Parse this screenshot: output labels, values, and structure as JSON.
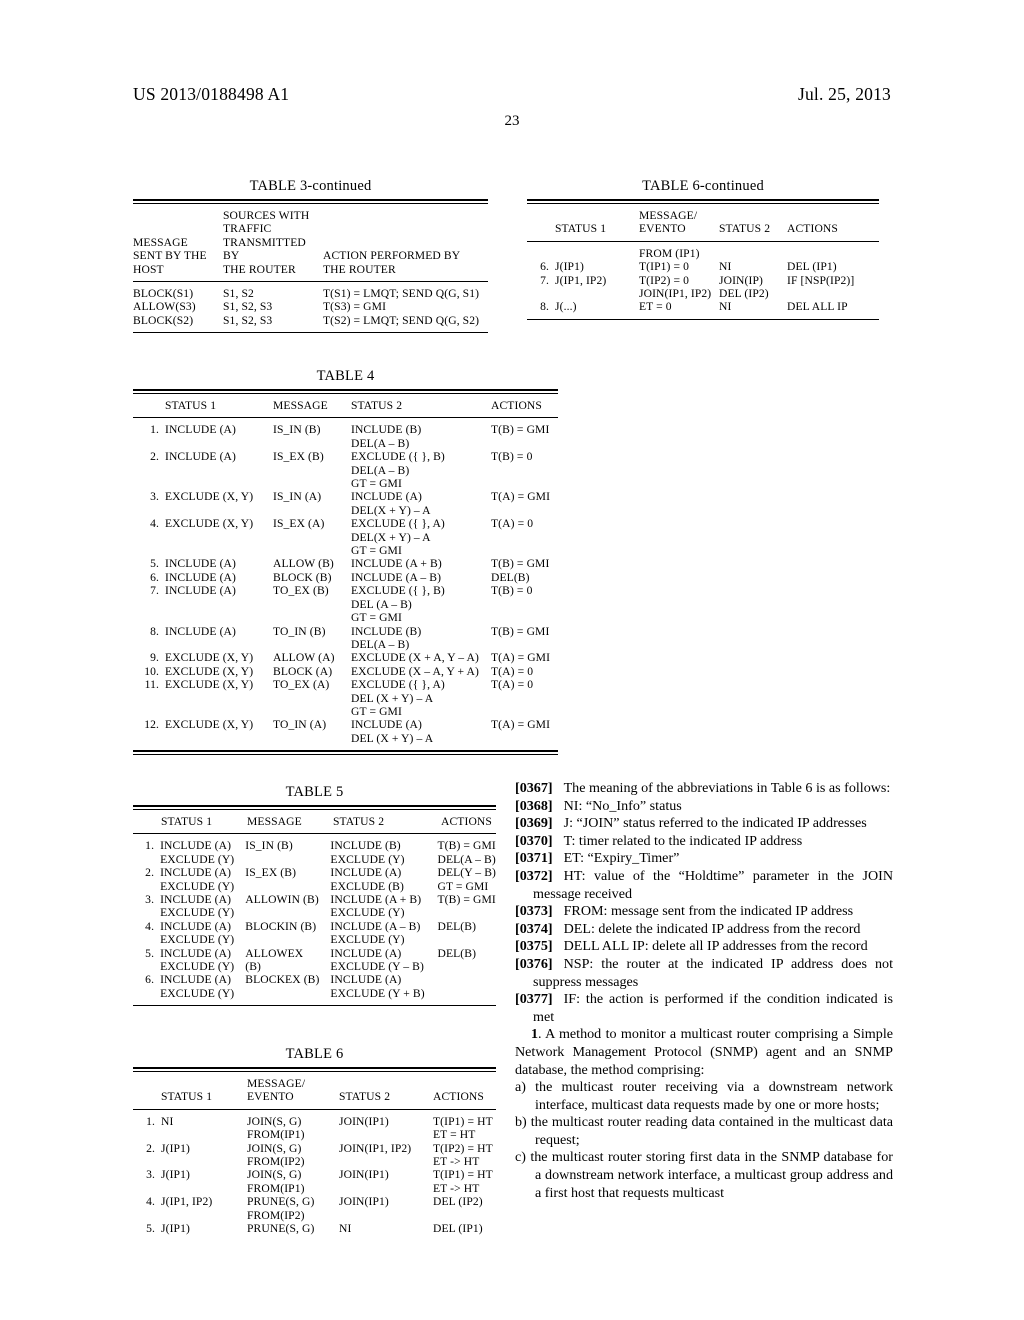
{
  "header": {
    "publication_number": "US 2013/0188498 A1",
    "publication_date": "Jul. 25, 2013",
    "page_number": "23"
  },
  "table3_continued": {
    "caption": "TABLE 3-continued",
    "headers": [
      [
        "",
        "SOURCES WITH",
        ""
      ],
      [
        "",
        "TRAFFIC",
        ""
      ],
      [
        "MESSAGE",
        "TRANSMITTED",
        ""
      ],
      [
        "SENT BY THE",
        "BY",
        "ACTION PERFORMED BY"
      ],
      [
        "HOST",
        "THE ROUTER",
        "THE ROUTER"
      ]
    ],
    "rows": [
      [
        "BLOCK(S1)",
        "S1, S2",
        "T(S1) = LMQT; SEND Q(G, S1)"
      ],
      [
        "ALLOW(S3)",
        "S1, S2, S3",
        "T(S3) = GMI"
      ],
      [
        "BLOCK(S2)",
        "S1, S2, S3",
        "T(S2) = LMQT; SEND Q(G, S2)"
      ]
    ]
  },
  "table6_continued": {
    "caption": "TABLE 6-continued",
    "headers_line1": [
      "",
      "",
      "MESSAGE/",
      "",
      ""
    ],
    "headers_line2": [
      "",
      "STATUS 1",
      "EVENTO",
      "STATUS 2",
      "ACTIONS"
    ],
    "rows": [
      {
        "num": "",
        "status1": "",
        "message": "FROM (IP1)",
        "status2": "",
        "actions": ""
      },
      {
        "num": "6.",
        "status1": "J(IP1)",
        "message": "T(IP1) = 0",
        "status2": "NI",
        "actions": "DEL (IP1)"
      },
      {
        "num": "7.",
        "status1": "J(IP1, IP2)",
        "message": "T(IP2) = 0",
        "status2": "JOIN(IP)",
        "actions": "IF [NSP(IP2)]"
      },
      {
        "num": "",
        "status1": "",
        "message": "JOIN(IP1, IP2)",
        "status2": "DEL (IP2)",
        "actions": ""
      },
      {
        "num": "8.",
        "status1": "J(...)",
        "message": "ET = 0",
        "status2": "NI",
        "actions": "DEL ALL IP"
      }
    ]
  },
  "table4": {
    "caption": "TABLE 4",
    "headers": [
      "",
      "STATUS 1",
      "MESSAGE",
      "STATUS 2",
      "ACTIONS"
    ],
    "rows": [
      {
        "num": "1.",
        "status1": "INCLUDE (A)",
        "message": "IS_IN (B)",
        "status2": "INCLUDE (B)",
        "actions": "T(B) = GMI"
      },
      {
        "num": "",
        "status1": "",
        "message": "",
        "status2": "DEL(A – B)",
        "actions": ""
      },
      {
        "num": "2.",
        "status1": "INCLUDE (A)",
        "message": "IS_EX (B)",
        "status2": "EXCLUDE ({ }, B)",
        "actions": "T(B) = 0"
      },
      {
        "num": "",
        "status1": "",
        "message": "",
        "status2": "DEL(A – B)",
        "actions": ""
      },
      {
        "num": "",
        "status1": "",
        "message": "",
        "status2": "GT = GMI",
        "actions": ""
      },
      {
        "num": "3.",
        "status1": "EXCLUDE (X, Y)",
        "message": "IS_IN (A)",
        "status2": "INCLUDE (A)",
        "actions": "T(A) = GMI"
      },
      {
        "num": "",
        "status1": "",
        "message": "",
        "status2": "DEL(X + Y) – A",
        "actions": ""
      },
      {
        "num": "4.",
        "status1": "EXCLUDE (X, Y)",
        "message": "IS_EX (A)",
        "status2": "EXCLUDE ({ }, A)",
        "actions": "T(A) = 0"
      },
      {
        "num": "",
        "status1": "",
        "message": "",
        "status2": "DEL(X + Y) – A",
        "actions": ""
      },
      {
        "num": "",
        "status1": "",
        "message": "",
        "status2": "GT = GMI",
        "actions": ""
      },
      {
        "num": "5.",
        "status1": "INCLUDE (A)",
        "message": "ALLOW (B)",
        "status2": "INCLUDE (A + B)",
        "actions": "T(B) = GMI"
      },
      {
        "num": "6.",
        "status1": "INCLUDE (A)",
        "message": "BLOCK (B)",
        "status2": "INCLUDE (A – B)",
        "actions": "DEL(B)"
      },
      {
        "num": "7.",
        "status1": "INCLUDE (A)",
        "message": "TO_EX (B)",
        "status2": "EXCLUDE ({ }, B)",
        "actions": "T(B) = 0"
      },
      {
        "num": "",
        "status1": "",
        "message": "",
        "status2": "DEL (A – B)",
        "actions": ""
      },
      {
        "num": "",
        "status1": "",
        "message": "",
        "status2": "GT = GMI",
        "actions": ""
      },
      {
        "num": "8.",
        "status1": "INCLUDE (A)",
        "message": "TO_IN (B)",
        "status2": "INCLUDE (B)",
        "actions": "T(B) = GMI"
      },
      {
        "num": "",
        "status1": "",
        "message": "",
        "status2": "DEL(A – B)",
        "actions": ""
      },
      {
        "num": "9.",
        "status1": "EXCLUDE (X, Y)",
        "message": "ALLOW (A)",
        "status2": "EXCLUDE (X + A, Y – A)",
        "actions": "T(A) = GMI"
      },
      {
        "num": "10.",
        "status1": "EXCLUDE (X, Y)",
        "message": "BLOCK (A)",
        "status2": "EXCLUDE (X – A, Y + A)",
        "actions": "T(A) = 0"
      },
      {
        "num": "11.",
        "status1": "EXCLUDE (X, Y)",
        "message": "TO_EX (A)",
        "status2": "EXCLUDE ({ }, A)",
        "actions": "T(A) = 0"
      },
      {
        "num": "",
        "status1": "",
        "message": "",
        "status2": "DEL (X + Y) – A",
        "actions": ""
      },
      {
        "num": "",
        "status1": "",
        "message": "",
        "status2": "GT = GMI",
        "actions": ""
      },
      {
        "num": "12.",
        "status1": "EXCLUDE (X, Y)",
        "message": "TO_IN (A)",
        "status2": "INCLUDE (A)",
        "actions": "T(A) = GMI"
      },
      {
        "num": "",
        "status1": "",
        "message": "",
        "status2": "DEL (X + Y) – A",
        "actions": ""
      }
    ]
  },
  "table5": {
    "caption": "TABLE 5",
    "headers": [
      "",
      "STATUS 1",
      "MESSAGE",
      "STATUS 2",
      "ACTIONS"
    ],
    "rows": [
      {
        "num": "1.",
        "status1": "INCLUDE (A)",
        "message": "IS_IN (B)",
        "status2": "INCLUDE (B)",
        "actions": "T(B) = GMI"
      },
      {
        "num": "",
        "status1": "EXCLUDE (Y)",
        "message": "",
        "status2": "EXCLUDE (Y)",
        "actions": "DEL(A – B)"
      },
      {
        "num": "2.",
        "status1": "INCLUDE (A)",
        "message": "IS_EX (B)",
        "status2": "INCLUDE (A)",
        "actions": "DEL(Y – B)"
      },
      {
        "num": "",
        "status1": "EXCLUDE (Y)",
        "message": "",
        "status2": "EXCLUDE (B)",
        "actions": "GT = GMI"
      },
      {
        "num": "3.",
        "status1": "INCLUDE (A)",
        "message": "ALLOWIN (B)",
        "status2": "INCLUDE (A + B)",
        "actions": "T(B) = GMI"
      },
      {
        "num": "",
        "status1": "EXCLUDE (Y)",
        "message": "",
        "status2": "EXCLUDE (Y)",
        "actions": ""
      },
      {
        "num": "4.",
        "status1": "INCLUDE (A)",
        "message": "BLOCKIN (B)",
        "status2": "INCLUDE (A – B)",
        "actions": "DEL(B)"
      },
      {
        "num": "",
        "status1": "EXCLUDE (Y)",
        "message": "",
        "status2": "EXCLUDE (Y)",
        "actions": ""
      },
      {
        "num": "5.",
        "status1": "INCLUDE (A)",
        "message": "ALLOWEX",
        "status2": "INCLUDE (A)",
        "actions": "DEL(B)"
      },
      {
        "num": "",
        "status1": "EXCLUDE (Y)",
        "message": "(B)",
        "status2": "EXCLUDE (Y – B)",
        "actions": ""
      },
      {
        "num": "6.",
        "status1": "INCLUDE (A)",
        "message": "BLOCKEX (B)",
        "status2": "INCLUDE (A)",
        "actions": ""
      },
      {
        "num": "",
        "status1": "EXCLUDE (Y)",
        "message": "",
        "status2": "EXCLUDE (Y + B)",
        "actions": ""
      }
    ]
  },
  "table6": {
    "caption": "TABLE 6",
    "headers_line1": [
      "",
      "",
      "MESSAGE/",
      "",
      ""
    ],
    "headers_line2": [
      "",
      "STATUS 1",
      "EVENTO",
      "STATUS 2",
      "ACTIONS"
    ],
    "rows": [
      {
        "num": "1.",
        "status1": "NI",
        "message": "JOIN(S, G)",
        "status2": "JOIN(IP1)",
        "actions": "T(IP1) = HT"
      },
      {
        "num": "",
        "status1": "",
        "message": "FROM(IP1)",
        "status2": "",
        "actions": "ET = HT"
      },
      {
        "num": "2.",
        "status1": "J(IP1)",
        "message": "JOIN(S, G)",
        "status2": "JOIN(IP1, IP2)",
        "actions": "T(IP2) = HT"
      },
      {
        "num": "",
        "status1": "",
        "message": "FROM(IP2)",
        "status2": "",
        "actions": "ET -> HT"
      },
      {
        "num": "3.",
        "status1": "J(IP1)",
        "message": "JOIN(S, G)",
        "status2": "JOIN(IP1)",
        "actions": "T(IP1) = HT"
      },
      {
        "num": "",
        "status1": "",
        "message": "FROM(IP1)",
        "status2": "",
        "actions": "ET -> HT"
      },
      {
        "num": "4.",
        "status1": "J(IP1, IP2)",
        "message": "PRUNE(S, G)",
        "status2": "JOIN(IP1)",
        "actions": "DEL (IP2)"
      },
      {
        "num": "",
        "status1": "",
        "message": "FROM(IP2)",
        "status2": "",
        "actions": ""
      },
      {
        "num": "5.",
        "status1": "J(IP1)",
        "message": "PRUNE(S, G)",
        "status2": "NI",
        "actions": "DEL (IP1)"
      }
    ]
  },
  "body_text": {
    "p0367": {
      "tag": "[0367]",
      "text": "The meaning of the abbreviations in Table 6 is as follows:"
    },
    "p0368": {
      "tag": "[0368]",
      "text": "NI: “No_Info” status"
    },
    "p0369": {
      "tag": "[0369]",
      "text": "J: “JOIN” status referred to the indicated IP addresses"
    },
    "p0370": {
      "tag": "[0370]",
      "text": "T: timer related to the indicated IP address"
    },
    "p0371": {
      "tag": "[0371]",
      "text": "ET: “Expiry_Timer”"
    },
    "p0372": {
      "tag": "[0372]",
      "text": "HT: value of the “Holdtime” parameter in the JOIN message received"
    },
    "p0373": {
      "tag": "[0373]",
      "text": "FROM: message sent from the indicated IP address"
    },
    "p0374": {
      "tag": "[0374]",
      "text": "DEL: delete the indicated IP address from the record"
    },
    "p0375": {
      "tag": "[0375]",
      "text": "DELL ALL IP: delete all IP addresses from the record"
    },
    "p0376": {
      "tag": "[0376]",
      "text": "NSP: the router at the indicated IP address does not suppress messages"
    },
    "p0377": {
      "tag": "[0377]",
      "text": "IF: the action is performed if the condition indicated is met"
    },
    "claim1_number": "1",
    "claim1": ". A method to monitor a multicast router comprising a Simple Network Management Protocol (SNMP) agent and an SNMP database, the method comprising:",
    "claim1a": "a) the multicast router receiving via a downstream network interface, multicast data requests made by one or more hosts;",
    "claim1b": "b) the multicast router reading data contained in the multicast data request;",
    "claim1c": "c) the multicast router storing first data in the SNMP database for a downstream network interface, a multicast group address and a first host that requests multicast"
  }
}
